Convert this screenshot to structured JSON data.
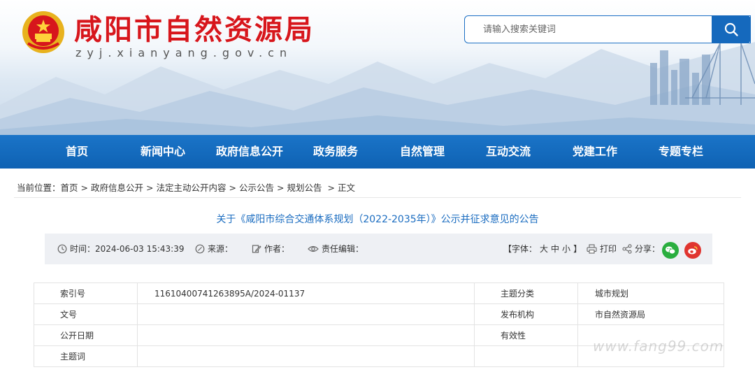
{
  "header": {
    "site_title": "咸阳市自然资源局",
    "site_domain": "zyj.xianyang.gov.cn",
    "search_placeholder": "请输入搜索关键词"
  },
  "nav": {
    "items": [
      "首页",
      "新闻中心",
      "政府信息公开",
      "政务服务",
      "自然管理",
      "互动交流",
      "党建工作",
      "专题专栏"
    ]
  },
  "breadcrumb": {
    "prefix": "当前位置：",
    "items": [
      "首页",
      "政府信息公开",
      "法定主动公开内容",
      "公示公告",
      "规划公告",
      "正文"
    ],
    "separator": ">"
  },
  "article": {
    "title": "关于《咸阳市综合交通体系规划（2022-2035年）》公示并征求意见的公告"
  },
  "meta": {
    "time_label": "时间：",
    "time_value": "2024-06-03 15:43:39",
    "source_label": "来源：",
    "author_label": "作者：",
    "editor_label": "责任编辑：",
    "font_label": "【字体：",
    "font_large": "大",
    "font_medium": "中",
    "font_small": "小",
    "font_close": "】",
    "print_label": "打印",
    "share_label": "分享："
  },
  "info_table": {
    "rows": [
      {
        "label": "索引号",
        "value": "11610400741263895A/2024-01137",
        "label2": "主题分类",
        "value2": "城市规划"
      },
      {
        "label": "文号",
        "value": "",
        "label2": "发布机构",
        "value2": "市自然资源局"
      },
      {
        "label": "公开日期",
        "value": "",
        "label2": "有效性",
        "value2": ""
      },
      {
        "label": "主题词",
        "value": "",
        "label2": "",
        "value2": ""
      }
    ]
  },
  "watermark": "www.fang99.com",
  "colors": {
    "brand_red": "#d7161c",
    "nav_blue": "#1569bd",
    "link_blue": "#1a6cc0",
    "wechat_green": "#2aae3f",
    "weibo_red": "#e0342f"
  }
}
